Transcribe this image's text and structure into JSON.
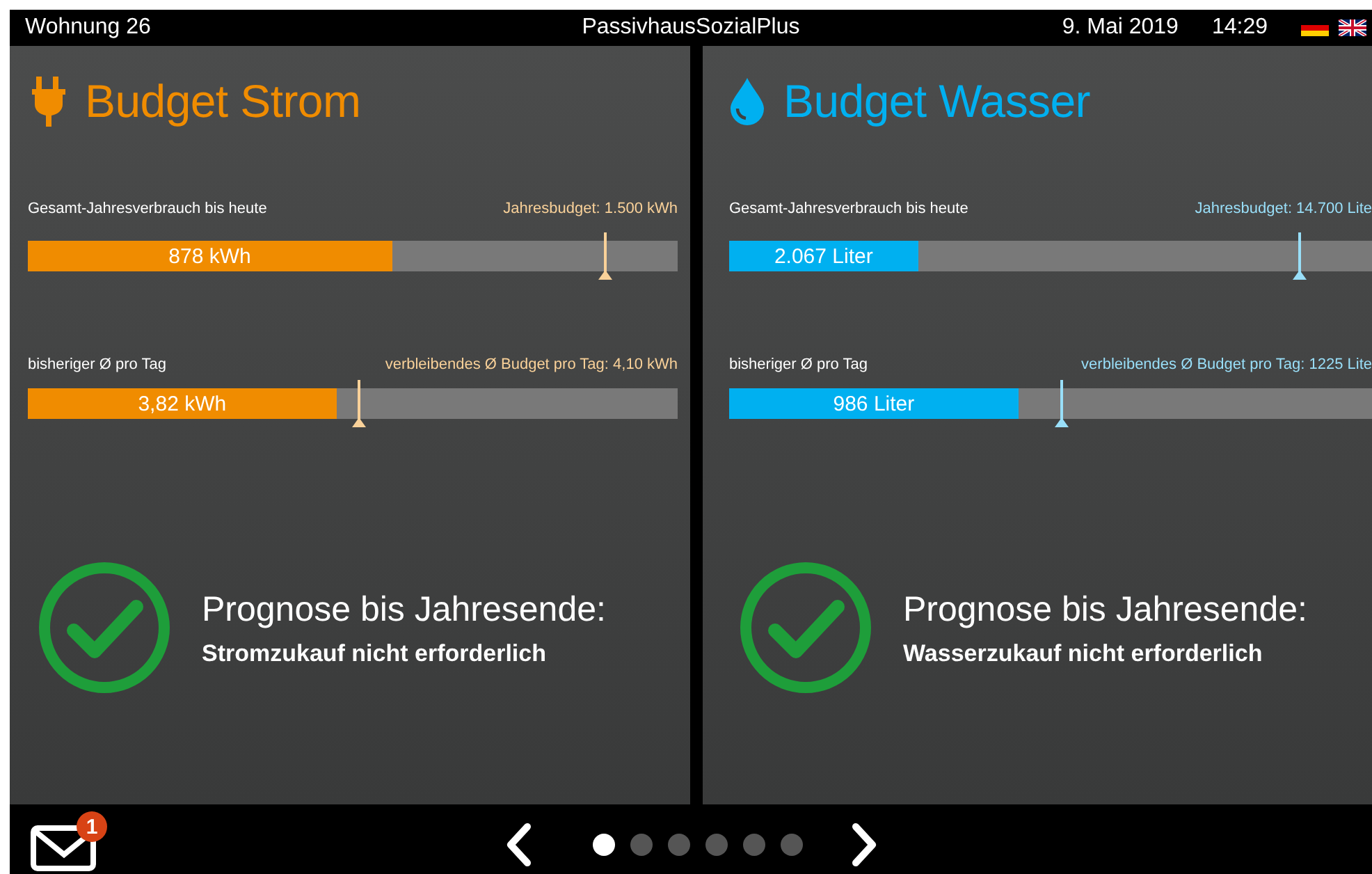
{
  "top_bar": {
    "apartment": "Wohnung 26",
    "title": "PassivhausSozialPlus",
    "date": "9. Mai 2019",
    "time": "14:29",
    "languages": [
      {
        "kind": "de"
      },
      {
        "kind": "uk"
      }
    ]
  },
  "panels": [
    {
      "kind": "power",
      "title": "Budget Strom",
      "color": "#f08c00",
      "bars": [
        {
          "label": "Gesamt-Jahresverbrauch bis heute",
          "hint": "Jahresbudget: 1.500 kWh",
          "value": "878 kWh",
          "fill": {
            "level": 0.56
          },
          "marker": {
            "level": 0.889
          }
        },
        {
          "label": "bisheriger Ø pro Tag",
          "hint": "verbleibendes Ø Budget pro Tag: 4,10 kWh",
          "value": "3,82 kWh",
          "fill": {
            "level": 0.475
          },
          "marker": {
            "level": 0.51
          }
        }
      ],
      "forecast": {
        "heading": "Prognose bis Jahresende:",
        "result": "Stromzukauf nicht erforderlich"
      }
    },
    {
      "kind": "water",
      "title": "Budget Wasser",
      "color": "#00b0f0",
      "bars": [
        {
          "label": "Gesamt-Jahresverbrauch bis heute",
          "hint": "Jahresbudget: 14.700 Lite",
          "value": "2.067 Liter",
          "fill": {
            "level": 0.294
          },
          "marker": {
            "level": 0.887
          }
        },
        {
          "label": "bisheriger Ø pro Tag",
          "hint": "verbleibendes Ø Budget pro Tag: 1225 Lite",
          "value": "986 Liter",
          "fill": {
            "level": 0.45
          },
          "marker": {
            "level": 0.517
          }
        }
      ],
      "forecast": {
        "heading": "Prognose bis Jahresende:",
        "result": "Wasserzukauf nicht erforderlich"
      }
    }
  ],
  "bottom_bar": {
    "messages_badge": "1",
    "pages": [
      {
        "selected": true
      },
      {
        "selected": false
      },
      {
        "selected": false
      },
      {
        "selected": false
      },
      {
        "selected": false
      },
      {
        "selected": false
      }
    ]
  }
}
